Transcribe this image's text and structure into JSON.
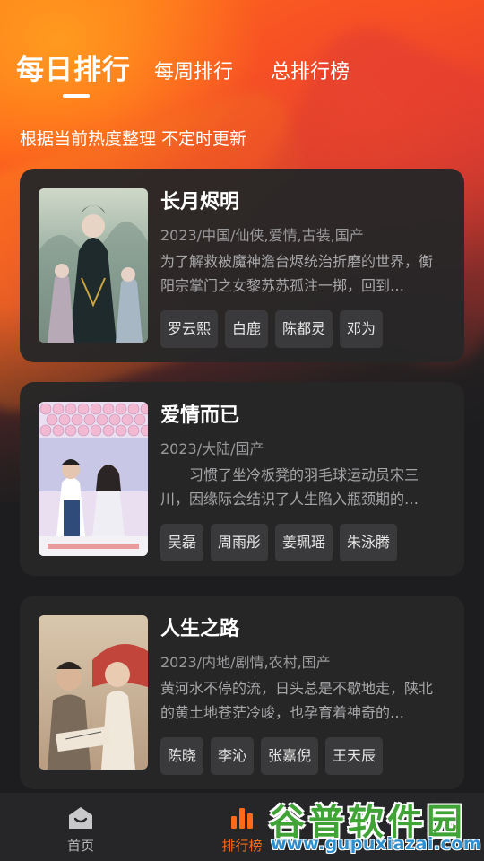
{
  "tabs": {
    "daily": "每日排行",
    "weekly": "每周排行",
    "total": "总排行榜"
  },
  "subtitle": "根据当前热度整理 不定时更新",
  "shows": [
    {
      "title": "长月烬明",
      "meta": "2023/中国/仙侠,爱情,古装,国产",
      "desc": "为了解救被魔神澹台烬统治折磨的世界，衡阳宗掌门之女黎苏苏孤注一掷，回到…",
      "actors": [
        "罗云熙",
        "白鹿",
        "陈都灵",
        "邓为"
      ]
    },
    {
      "title": "爱情而已",
      "meta": "2023/大陆/国产",
      "desc": "　　习惯了坐冷板凳的羽毛球运动员宋三川，因缘际会结识了人生陷入瓶颈期的…",
      "actors": [
        "吴磊",
        "周雨彤",
        "姜珮瑶",
        "朱泳腾"
      ]
    },
    {
      "title": "人生之路",
      "meta": "2023/内地/剧情,农村,国产",
      "desc": "黄河水不停的流，日头总是不歇地走，陕北的黄土地苍茫冷峻，也孕育着神奇的…",
      "actors": [
        "陈晓",
        "李沁",
        "张嘉倪",
        "王天辰"
      ]
    }
  ],
  "bottom_nav": {
    "home_label": "首页",
    "rank_label": "排行榜",
    "active_color": "#ff6a1a"
  },
  "watermark": {
    "name": "谷普软件园",
    "url": "www.gupuxiazai.com"
  },
  "colors": {
    "accent": "#ff6a1a",
    "card_bg": "#262628",
    "chip_bg": "#3a3a3c"
  }
}
